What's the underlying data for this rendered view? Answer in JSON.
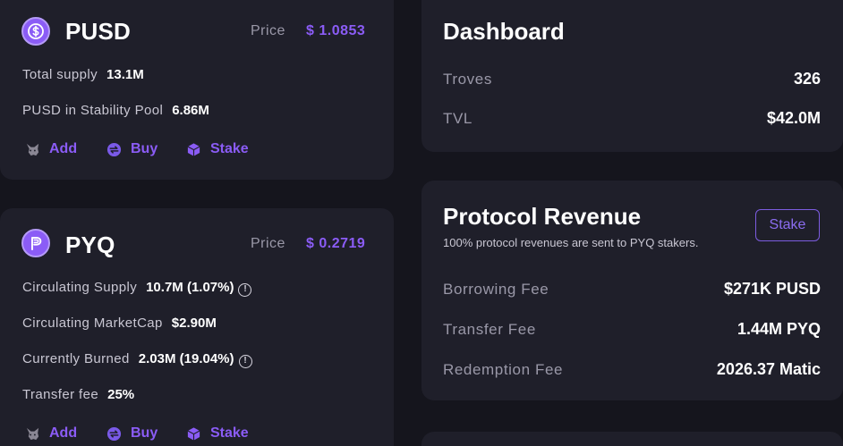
{
  "pusd": {
    "name": "PUSD",
    "price_label": "Price",
    "price_value": "$ 1.0853",
    "stats": [
      {
        "label": "Total supply",
        "value": "13.1M"
      },
      {
        "label": "PUSD in Stability Pool",
        "value": "6.86M"
      }
    ],
    "actions": {
      "add": "Add",
      "buy": "Buy",
      "stake": "Stake"
    }
  },
  "pyq": {
    "name": "PYQ",
    "price_label": "Price",
    "price_value": "$ 0.2719",
    "stats": [
      {
        "label": "Circulating Supply",
        "value": "10.7M (1.07%)"
      },
      {
        "label": "Circulating MarketCap",
        "value": "$2.90M"
      },
      {
        "label": "Currently Burned",
        "value": "2.03M (19.04%)"
      },
      {
        "label": "Transfer fee",
        "value": "25%"
      }
    ],
    "info_glyph": "!",
    "actions": {
      "add": "Add",
      "buy": "Buy",
      "stake": "Stake"
    }
  },
  "dashboard": {
    "title": "Dashboard",
    "rows": [
      {
        "label": "Troves",
        "value": "326"
      },
      {
        "label": "TVL",
        "value": "$42.0M"
      }
    ]
  },
  "revenue": {
    "title": "Protocol Revenue",
    "subtitle": "100% protocol revenues are sent to PYQ stakers.",
    "stake_button": "Stake",
    "rows": [
      {
        "label": "Borrowing Fee",
        "value": "$271K PUSD"
      },
      {
        "label": "Transfer Fee",
        "value": "1.44M PYQ"
      },
      {
        "label": "Redemption Fee",
        "value": "2026.37 Matic"
      }
    ]
  },
  "colors": {
    "accent": "#8b5cf6",
    "background": "#15151d",
    "card": "#1f1f2a"
  },
  "icons": {
    "pusd_logo": "dollar-coin-icon",
    "pyq_logo": "pyq-coin-icon",
    "add": "metamask-fox-icon",
    "buy": "exchange-icon",
    "stake": "cube-icon",
    "info": "info-icon"
  }
}
